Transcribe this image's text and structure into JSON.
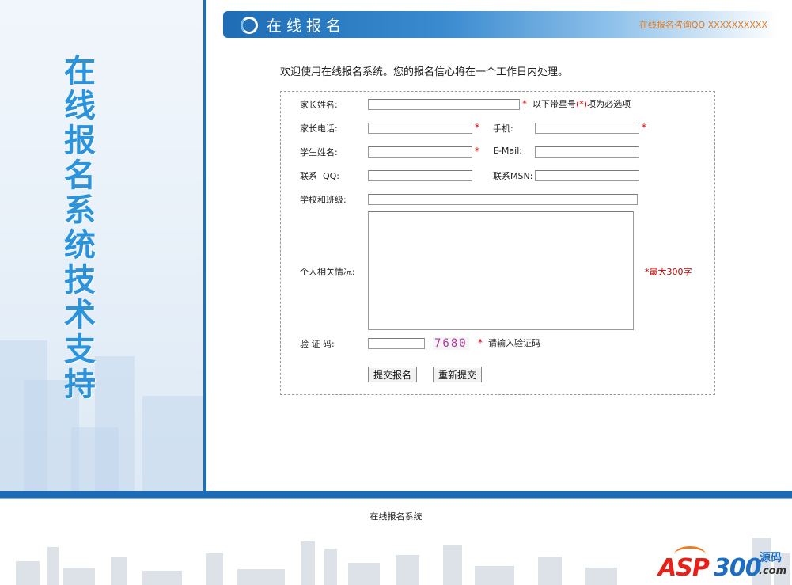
{
  "sidebar": {
    "vertical_title": [
      "在",
      "线",
      "报",
      "名",
      "系",
      "统",
      "技",
      "术",
      "支",
      "持"
    ]
  },
  "header": {
    "title": "在线报名",
    "qq_label": "在线报名咨询QQ XXXXXXXXXX"
  },
  "welcome": "欢迎使用在线报名系统。您的报名信心将在一个工作日内处理。",
  "form": {
    "parent_name_label": "家长姓名:",
    "required_note_prefix": "以下带星号",
    "required_note_star": "(*)",
    "required_note_suffix": "项为必选项",
    "parent_phone_label": "家长电话:",
    "mobile_label": "手机:",
    "student_name_label": "学生姓名:",
    "email_label": "E-Mail:",
    "qq_label": "联系  QQ:",
    "msn_label": "联系MSN:",
    "school_label": "学校和班级:",
    "info_label": "个人相关情况:",
    "info_max_note": "*最大300字",
    "captcha_label": "验 证 码:",
    "captcha_code": "7680",
    "captcha_hint": "请输入验证码",
    "star": "*",
    "submit_label": "提交报名",
    "reset_label": "重新提交"
  },
  "footer": {
    "text": "在线报名系统"
  },
  "logo": {
    "asp": "ASP",
    "num": "300",
    "yuanma": "源码",
    "com": ".com"
  },
  "colors": {
    "accent": "#1f6fb8",
    "title_blue": "#2a93dc",
    "required_red": "#e00000",
    "qq_orange": "#e07a1e"
  }
}
